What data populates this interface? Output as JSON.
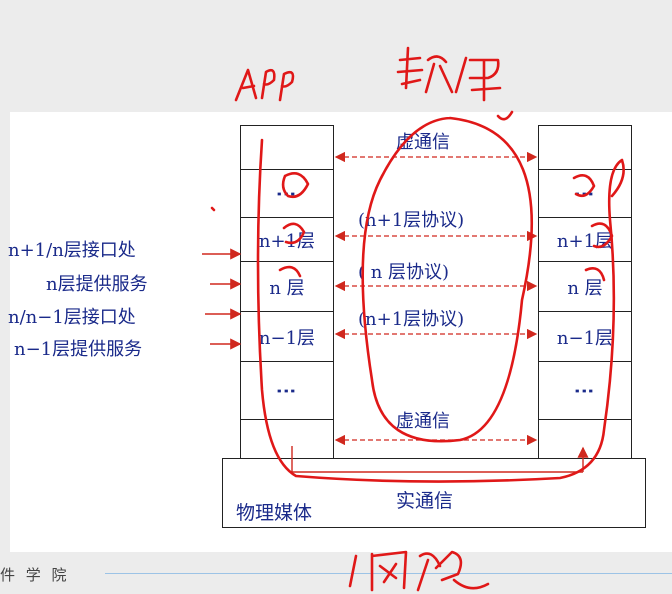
{
  "footer": {
    "text": "件 学 院"
  },
  "left_stack": {
    "upper_label": "n+1层",
    "mid_label": "n 层",
    "lower_label": "n−1层"
  },
  "right_stack": {
    "upper_label": "n+1层",
    "mid_label": "n 层",
    "lower_label": "n−1层"
  },
  "side_labels": {
    "interface_upper": "n+1/n层接口处",
    "service_n": "n层提供服务",
    "interface_lower": "n/n−1层接口处",
    "service_n_minus_1": "n−1层提供服务"
  },
  "peer_links": {
    "virtual_top": "虚通信",
    "protocol_upper": "(n+1层协议)",
    "protocol_n": "( n  层协议)",
    "protocol_lower": "(n+1层协议)",
    "virtual_bottom": "虚通信"
  },
  "medium": {
    "label": "物理媒体",
    "real_comm": "实通信"
  },
  "colors": {
    "diagram_text": "#1a2a8a",
    "arrow_red": "#d0281e",
    "handwriting": "#e01818"
  }
}
